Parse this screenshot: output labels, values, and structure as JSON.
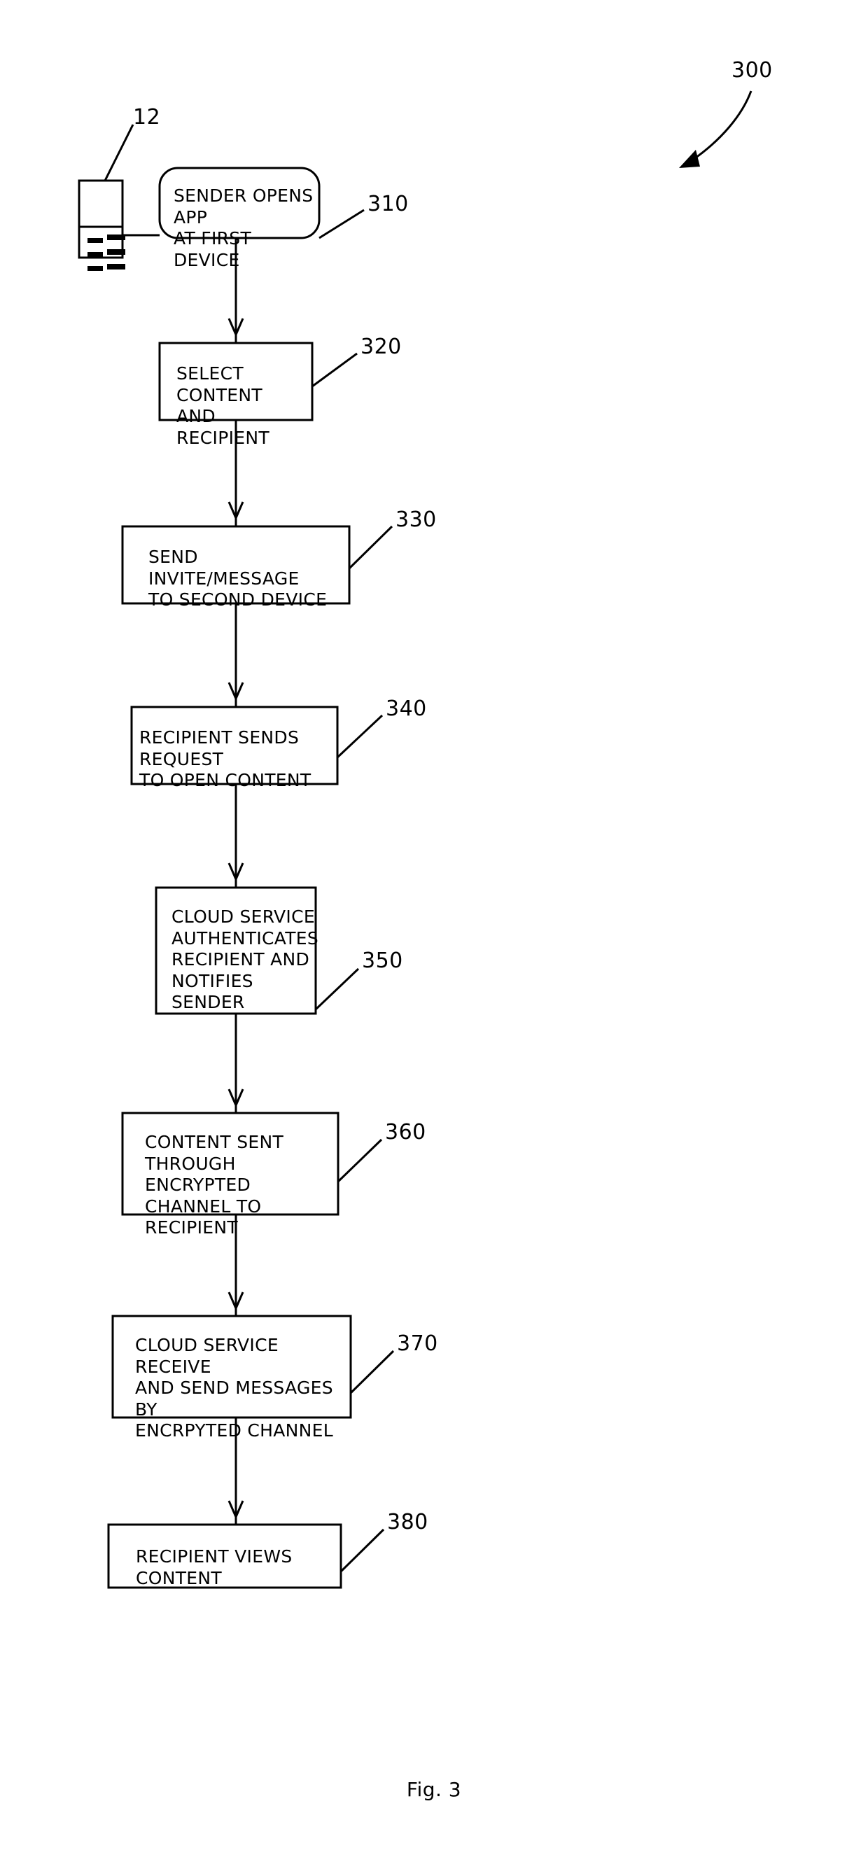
{
  "figure": {
    "caption": "Fig. 3",
    "overall_ref": "300",
    "device_ref": "12"
  },
  "device": {
    "name": "first-device-icon",
    "ref": "12"
  },
  "flow": {
    "steps": [
      {
        "ref": "310",
        "shape": "rounded-rect",
        "text": "SENDER OPENS APP\nAT FIRST DEVICE",
        "lines": [
          "SENDER OPENS APP",
          "AT FIRST DEVICE"
        ]
      },
      {
        "ref": "320",
        "shape": "rect",
        "text": "SELECT CONTENT\nAND RECIPIENT",
        "lines": [
          "SELECT CONTENT",
          "AND RECIPIENT"
        ]
      },
      {
        "ref": "330",
        "shape": "rect",
        "text": "SEND INVITE/MESSAGE\nTO SECOND DEVICE",
        "lines": [
          "SEND INVITE/MESSAGE",
          "TO SECOND DEVICE"
        ]
      },
      {
        "ref": "340",
        "shape": "rect",
        "text": "RECIPIENT SENDS REQUEST\nTO OPEN CONTENT",
        "lines": [
          "RECIPIENT SENDS REQUEST",
          "TO OPEN CONTENT"
        ]
      },
      {
        "ref": "350",
        "shape": "rect",
        "text": "CLOUD SERVICE\nAUTHENTICATES\nRECIPIENT AND\nNOTIFIES SENDER",
        "lines": [
          "CLOUD SERVICE",
          "AUTHENTICATES",
          "RECIPIENT AND",
          "NOTIFIES SENDER"
        ]
      },
      {
        "ref": "360",
        "shape": "rect",
        "text": "CONTENT SENT\nTHROUGH ENCRYPTED\nCHANNEL TO RECIPIENT",
        "lines": [
          "CONTENT SENT",
          "THROUGH ENCRYPTED",
          "CHANNEL TO RECIPIENT"
        ]
      },
      {
        "ref": "370",
        "shape": "rect",
        "text": "CLOUD SERVICE RECEIVE\nAND SEND MESSAGES BY\nENCRPYTED CHANNEL",
        "lines": [
          "CLOUD SERVICE RECEIVE",
          "AND SEND MESSAGES BY",
          "ENCRPYTED CHANNEL"
        ]
      },
      {
        "ref": "380",
        "shape": "rect",
        "text": "RECIPIENT VIEWS CONTENT",
        "lines": [
          "RECIPIENT VIEWS CONTENT"
        ]
      }
    ]
  },
  "style": {
    "stroke": "#000000",
    "background": "#ffffff"
  }
}
